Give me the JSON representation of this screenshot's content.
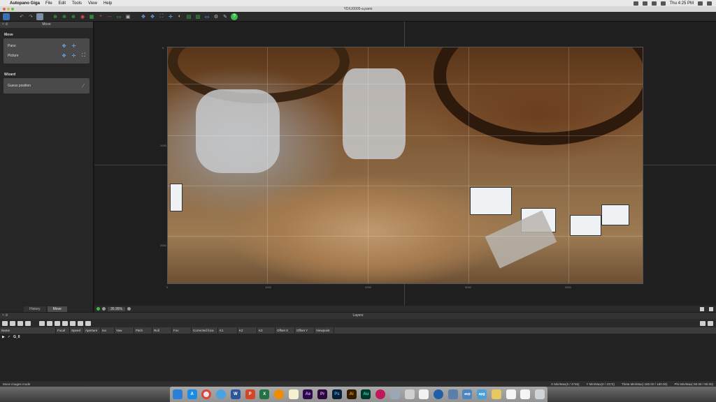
{
  "menubar": {
    "app_name": "Autopano Giga",
    "items": [
      "File",
      "Edit",
      "Tools",
      "View",
      "Help"
    ],
    "clock": "Thu 4:25 PM"
  },
  "window": {
    "title": "YDXJ0005-a.pano"
  },
  "left_panel": {
    "header": "Move",
    "move_section": "Move",
    "pano_label": "Pano",
    "picture_label": "Picture",
    "wizard_section": "Wizard",
    "guess_position_label": "Guess position",
    "tabs": [
      "History",
      "Move"
    ]
  },
  "editor": {
    "x_ticks": [
      "0",
      "1000",
      "2000",
      "3000",
      "4000"
    ],
    "y_ticks": [
      "0",
      "1000",
      "2000"
    ],
    "zoom": "35.95%"
  },
  "layers": {
    "header": "Layers",
    "columns": [
      "Name",
      "Focal",
      "Speed",
      "Aperture",
      "Iso",
      "Yaw",
      "Pitch",
      "Roll",
      "Fov",
      "Corrected foca",
      "K1",
      "K2",
      "K3",
      "Offset X",
      "Offset Y",
      "Viewpoint"
    ],
    "rows": [
      {
        "name": "G_0"
      }
    ]
  },
  "status": {
    "mode": "Move images mode",
    "x_range": "X Min/Max(0 / 4746)",
    "y_range": "Y Min/Max(0 / 2373)",
    "theta_range": "Theta Min/Max(-180.00 / 180.00)",
    "phi_range": "Phi Min/Max(-90.00 / 90.00)"
  },
  "dock": {
    "apps": [
      "finder-icon",
      "appstore-icon",
      "chrome-icon",
      "safari-icon",
      "word-icon",
      "powerpoint-icon",
      "excel-icon",
      "vlc-icon",
      "notes-icon",
      "aftereffects-icon",
      "premiere-icon",
      "photoshop-icon",
      "illustrator-icon",
      "audition-icon",
      "davinci-icon",
      "preview-icon",
      "autopano-icon",
      "photos-icon",
      "quicktime-icon",
      "gopro-icon",
      "autopano-video-icon",
      "autopano-giga-icon",
      "folder-icon",
      "document-icon",
      "document2-icon",
      "trash-icon"
    ],
    "labels": {
      "ae": "Ae",
      "pr": "Pr",
      "ps": "Ps",
      "ai": "Ai",
      "au": "Au",
      "w": "W",
      "x": "X",
      "p": "P",
      "avp": "avp",
      "apg": "apg"
    }
  }
}
